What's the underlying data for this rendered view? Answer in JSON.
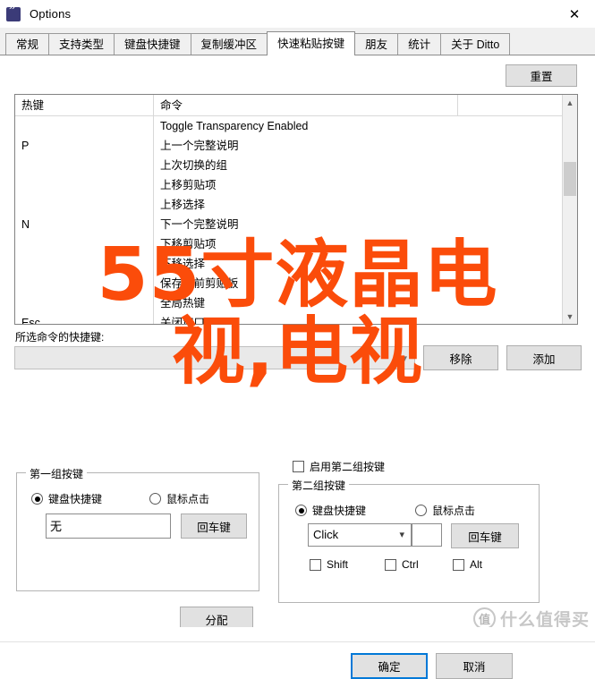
{
  "window": {
    "title": "Options",
    "icon": "ditto-quote-icon",
    "close_label": "✕"
  },
  "tabs": [
    {
      "label": "常规",
      "active": false
    },
    {
      "label": "支持类型",
      "active": false
    },
    {
      "label": "键盘快捷键",
      "active": false
    },
    {
      "label": "复制缓冲区",
      "active": false
    },
    {
      "label": "快速粘贴按键",
      "active": true
    },
    {
      "label": "朋友",
      "active": false
    },
    {
      "label": "统计",
      "active": false
    },
    {
      "label": "关于 Ditto",
      "active": false
    }
  ],
  "toolbar": {
    "reset_label": "重置"
  },
  "list": {
    "columns": [
      "热键",
      "命令",
      ""
    ],
    "rows": [
      {
        "hotkey": "",
        "command": "Toggle Transparency Enabled"
      },
      {
        "hotkey": "P",
        "command": "上一个完整说明"
      },
      {
        "hotkey": "",
        "command": "上次切换的组"
      },
      {
        "hotkey": "",
        "command": "上移剪贴项"
      },
      {
        "hotkey": "",
        "command": "上移选择"
      },
      {
        "hotkey": "N",
        "command": "下一个完整说明"
      },
      {
        "hotkey": "",
        "command": "下移剪贴项"
      },
      {
        "hotkey": "",
        "command": "下移选择"
      },
      {
        "hotkey": "",
        "command": "保存当前剪贴板"
      },
      {
        "hotkey": "",
        "command": "全局热键"
      },
      {
        "hotkey": "Esc",
        "command": "关闭窗口"
      }
    ],
    "scroll_up_icon": "chevron-up-icon",
    "scroll_down_icon": "chevron-down-icon"
  },
  "shortcut": {
    "label": "所选命令的快捷键:",
    "value": "",
    "dropdown_icon": "chevron-down-icon",
    "remove_label": "移除",
    "add_label": "添加"
  },
  "group1": {
    "title": "第一组按键",
    "radio_keyboard": "键盘快捷键",
    "radio_mouse": "鼠标点击",
    "selected": "keyboard",
    "key_value": "无",
    "enter_label": "回车键"
  },
  "enable_group2": {
    "label": "启用第二组按键",
    "checked": false
  },
  "group2": {
    "title": "第二组按键",
    "radio_keyboard": "键盘快捷键",
    "radio_mouse": "鼠标点击",
    "selected": "keyboard",
    "combo_value": "Click",
    "combo_icon": "chevron-down-icon",
    "enter_label": "回车键",
    "modifiers": [
      {
        "label": "Shift",
        "checked": false
      },
      {
        "label": "Ctrl",
        "checked": false
      },
      {
        "label": "Alt",
        "checked": false
      }
    ]
  },
  "actions": {
    "assign_label": "分配",
    "ok_label": "确定",
    "cancel_label": "取消"
  },
  "overlay": {
    "line1": "55寸液晶电",
    "line2": "视,电视",
    "color": "#fb4c0a"
  },
  "watermark": {
    "mark": "值",
    "text": "什么值得买"
  }
}
